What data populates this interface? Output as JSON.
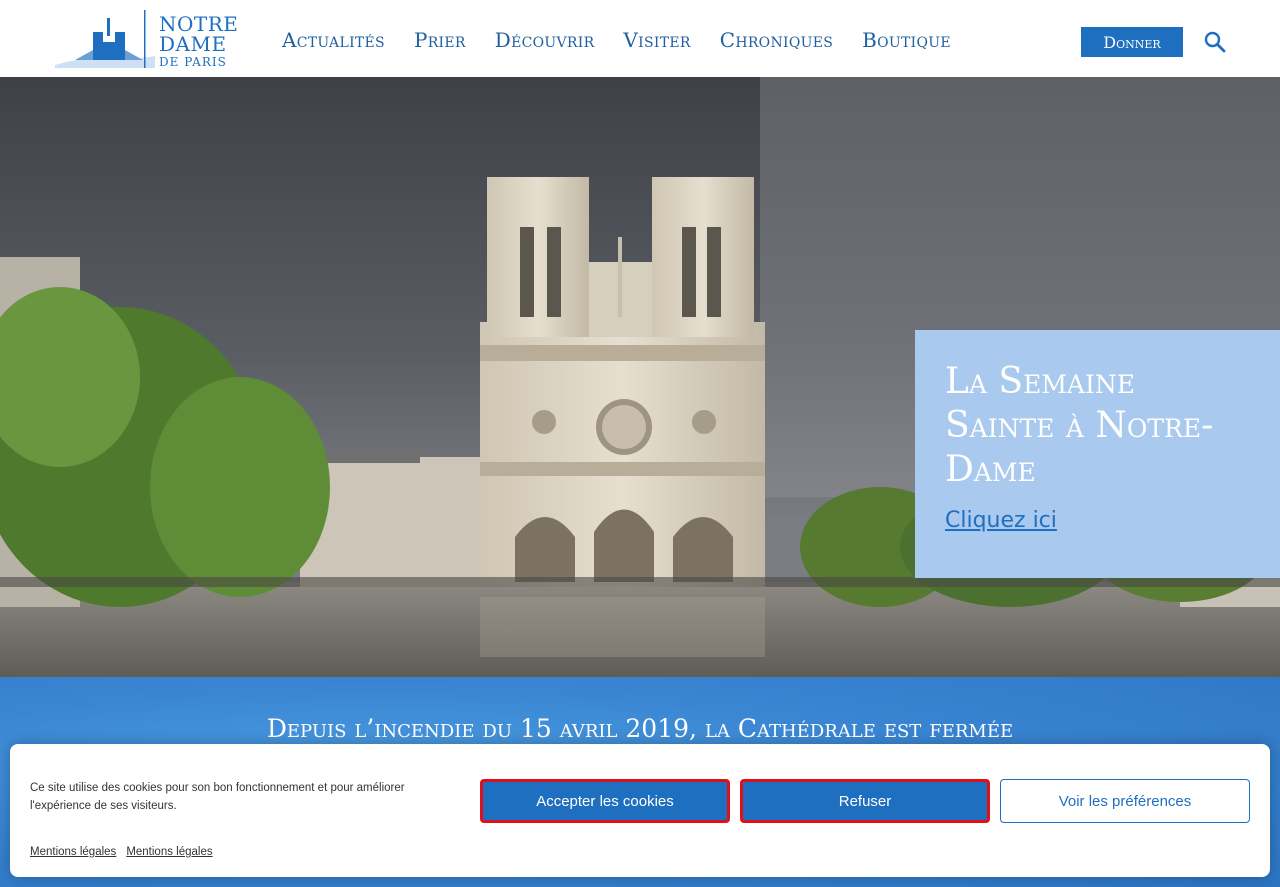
{
  "brand": {
    "line1": "Notre",
    "line2": "Dame",
    "line3": "de Paris",
    "color": "#1f6fc0"
  },
  "nav": {
    "items": [
      {
        "label": "Actualités"
      },
      {
        "label": "Prier"
      },
      {
        "label": "Découvrir"
      },
      {
        "label": "Visiter"
      },
      {
        "label": "Chroniques"
      },
      {
        "label": "Boutique"
      }
    ],
    "donate_label": "Donner",
    "search_icon": "search-icon"
  },
  "promo": {
    "title": "La Semaine Sainte à Notre-Dame",
    "link": "Cliquez ici",
    "background": "#a9c9ef"
  },
  "band": {
    "title": "Depuis l’incendie du 15 avril 2019, la Cathédrale est fermée"
  },
  "cookie": {
    "message": "Ce site utilise des cookies pour son bon fonctionnement et pour améliorer l'expérience de ses visiteurs.",
    "accept_label": "Accepter les cookies",
    "refuse_label": "Refuser",
    "prefs_label": "Voir les préférences",
    "links": [
      "Mentions légales",
      "Mentions légales"
    ]
  }
}
